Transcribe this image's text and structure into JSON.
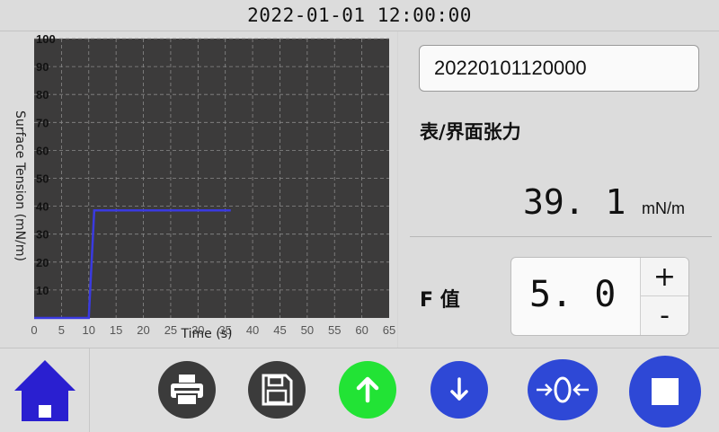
{
  "header": {
    "datetime": "2022-01-01 12:00:00"
  },
  "chart_data": {
    "type": "line",
    "xlabel": "Time (s)",
    "ylabel": "Surface Tension (mN/m)",
    "xlim": [
      0,
      65
    ],
    "ylim": [
      0,
      100
    ],
    "x_ticks": [
      0,
      5,
      10,
      15,
      20,
      25,
      30,
      35,
      40,
      45,
      50,
      55,
      60,
      65
    ],
    "y_ticks": [
      10,
      20,
      30,
      40,
      50,
      60,
      70,
      80,
      90,
      100
    ],
    "grid": true,
    "series": [
      {
        "x": [
          0,
          10,
          11,
          36
        ],
        "y": [
          0,
          0,
          38.5,
          38.5
        ],
        "color": "#3a3ae0"
      }
    ]
  },
  "sample": {
    "id": "20220101120000"
  },
  "measurement": {
    "label": "表/界面张力",
    "value": "39. 1",
    "unit": "mN/m"
  },
  "f_value": {
    "label": "F 值",
    "value": "5. 0",
    "plus": "+",
    "minus": "-"
  },
  "toolbar": [
    {
      "name": "home-button",
      "icon": "home-icon",
      "color": "#2a1fd0"
    },
    {
      "name": "print-button",
      "icon": "printer-icon",
      "color": "#3b3b3b"
    },
    {
      "name": "save-button",
      "icon": "floppy-disk-icon",
      "color": "#3b3b3b"
    },
    {
      "name": "move-up-button",
      "icon": "arrow-up-icon",
      "color": "#22e335"
    },
    {
      "name": "move-down-button",
      "icon": "arrow-down-icon",
      "color": "#2e48d6"
    },
    {
      "name": "zero-calibrate-button",
      "icon": "zero-calibrate-icon",
      "color": "#2e48d6"
    },
    {
      "name": "stop-button",
      "icon": "stop-icon",
      "color": "#2e48d6"
    }
  ]
}
